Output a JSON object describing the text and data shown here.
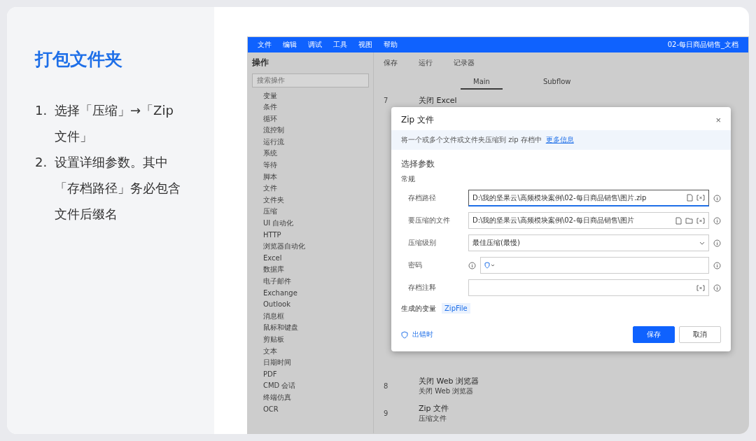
{
  "title": "打包文件夹",
  "steps": [
    {
      "number": "1.",
      "text": "选择「压缩」→「Zip 文件」"
    },
    {
      "number": "2.",
      "text": "设置详细参数。其中「存档路径」务必包含文件后缀名"
    }
  ],
  "app": {
    "menu": [
      "文件",
      "编辑",
      "调试",
      "工具",
      "视图",
      "帮助"
    ],
    "window_title": "02-每日商品销售_文档",
    "actions_title": "操作",
    "search": {
      "placeholder": "搜索操作"
    },
    "categories": [
      "变量",
      "条件",
      "循环",
      "流控制",
      "运行流",
      "系统",
      "等待",
      "脚本",
      "文件",
      "文件夹",
      "压缩",
      "UI 自动化",
      "HTTP",
      "浏览器自动化",
      "Excel",
      "数据库",
      "电子邮件",
      "Exchange",
      "Outlook",
      "消息框",
      "鼠标和键盘",
      "剪贴板",
      "文本",
      "日期时间",
      "PDF",
      "CMD 会话",
      "终端仿真",
      "OCR"
    ],
    "toolbar": [
      "保存",
      "运行",
      "记录器"
    ],
    "tabs": [
      {
        "label": "Main",
        "selected": true
      },
      {
        "label": "Subflow",
        "selected": false
      }
    ],
    "steps": [
      {
        "number": "7",
        "title": "关闭 Excel"
      },
      {
        "number": "8",
        "title": "关闭 Web 浏览器",
        "detail": "关闭 Web 浏览器"
      },
      {
        "number": "9",
        "title": "Zip 文件",
        "detail": "压缩文件"
      }
    ],
    "dialog": {
      "title": "Zip 文件",
      "close": "×",
      "info": "将一个或多个文件或文件夹压缩到 zip 存档中",
      "info_link": "更多信息",
      "section": "选择参数",
      "group": "常规",
      "fields": [
        {
          "kind": "text",
          "label": "存档路径",
          "value": "D:\\我的坚果云\\高频模块案例\\02-每日商品销售\\图片.zip",
          "focused": true,
          "file_icon": true,
          "folder_icon": false
        },
        {
          "kind": "text",
          "label": "要压缩的文件",
          "value": "D:\\我的坚果云\\高频模块案例\\02-每日商品销售\\图片",
          "focused": false,
          "file_icon": true,
          "folder_icon": true
        },
        {
          "kind": "select",
          "label": "压缩级别",
          "value": "最佳压缩(最慢)"
        },
        {
          "kind": "password",
          "label": "密码"
        },
        {
          "kind": "text",
          "label": "存档注释",
          "focused": false,
          "file_icon": false,
          "folder_icon": false
        }
      ],
      "variables_label": "生成的变量",
      "variable": "ZipFile",
      "on_error": "出错时",
      "save": "保存",
      "cancel": "取消"
    }
  }
}
